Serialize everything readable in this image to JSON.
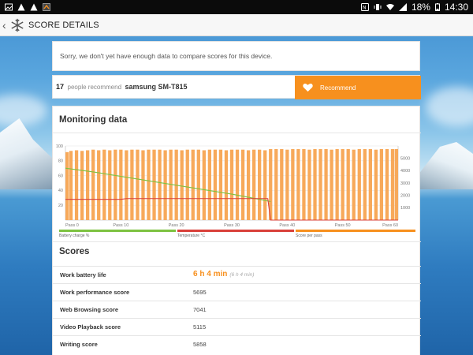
{
  "status_bar": {
    "battery_percent": "18%",
    "time": "14:30"
  },
  "app_bar": {
    "title": "SCORE DETAILS"
  },
  "notice": {
    "text": "Sorry, we don't yet have enough data to compare scores for this device."
  },
  "recommend": {
    "count": "17",
    "label": "people recommend",
    "device": "samsung SM-T815",
    "button_label": "Recommend"
  },
  "monitoring": {
    "title": "Monitoring data",
    "legend": [
      "Battery charge %",
      "Temperature °C",
      "Score per pass"
    ],
    "colors": {
      "battery": "#7dc241",
      "temperature": "#d9403a",
      "score": "#f7901e"
    }
  },
  "chart_data": {
    "type": "bar",
    "x_ticks": [
      "Pass 0",
      "Pass 10",
      "Pass 20",
      "Pass 30",
      "Pass 40",
      "Pass 50",
      "Pass 60"
    ],
    "y_left_ticks": [
      "20",
      "40",
      "60",
      "80",
      "100"
    ],
    "y_right_ticks": [
      "1000",
      "2000",
      "3000",
      "4000",
      "5000"
    ],
    "y_left_lim": [
      0,
      100
    ],
    "y_right_lim": [
      0,
      6000
    ],
    "series": [
      {
        "name": "Score per pass",
        "type": "bar",
        "axis": "right",
        "x": [
          0,
          1,
          2,
          3,
          4,
          5,
          6,
          7,
          8,
          9,
          10,
          11,
          12,
          13,
          14,
          15,
          16,
          17,
          18,
          19,
          20,
          21,
          22,
          23,
          24,
          25,
          26,
          27,
          28,
          29,
          30,
          31,
          32,
          33,
          34,
          35,
          36,
          37,
          38,
          39,
          40,
          41,
          42,
          43,
          44,
          45,
          46,
          47,
          48,
          49,
          50,
          51,
          52,
          53,
          54,
          55,
          56,
          57,
          58,
          59,
          60
        ],
        "values": [
          5500,
          5600,
          5650,
          5600,
          5650,
          5700,
          5650,
          5700,
          5650,
          5700,
          5700,
          5650,
          5700,
          5700,
          5650,
          5700,
          5700,
          5700,
          5650,
          5700,
          5700,
          5650,
          5700,
          5700,
          5700,
          5650,
          5700,
          5700,
          5700,
          5650,
          5700,
          5700,
          5700,
          5650,
          5700,
          5700,
          5650,
          5750,
          5750,
          5750,
          5700,
          5750,
          5750,
          5750,
          5700,
          5750,
          5750,
          5750,
          5700,
          5750,
          5750,
          5750,
          5700,
          5750,
          5750,
          5750,
          5700,
          5750,
          5750,
          5750,
          5750
        ]
      },
      {
        "name": "Battery charge %",
        "type": "line",
        "axis": "left",
        "x": [
          0,
          5,
          10,
          15,
          20,
          25,
          30,
          35,
          37
        ],
        "values": [
          70,
          65,
          59,
          53,
          47,
          41,
          35,
          28,
          25
        ]
      },
      {
        "name": "Temperature °C",
        "type": "line",
        "axis": "left",
        "x": [
          0,
          5,
          10,
          11,
          15,
          20,
          25,
          30,
          36.5,
          37,
          38,
          40,
          50,
          60
        ],
        "values": [
          28,
          28,
          28,
          29,
          29,
          29,
          29,
          29,
          29,
          0,
          0,
          0,
          0,
          0
        ]
      }
    ]
  },
  "scores": {
    "title": "Scores",
    "rows": [
      {
        "label": "Work battery life",
        "value": "6 h 4 min",
        "sub": "(6 h 4 min)"
      },
      {
        "label": "Work performance score",
        "value": "5695"
      },
      {
        "label": "Web Browsing score",
        "value": "7041"
      },
      {
        "label": "Video Playback score",
        "value": "5115"
      },
      {
        "label": "Writing score",
        "value": "5858"
      }
    ]
  }
}
